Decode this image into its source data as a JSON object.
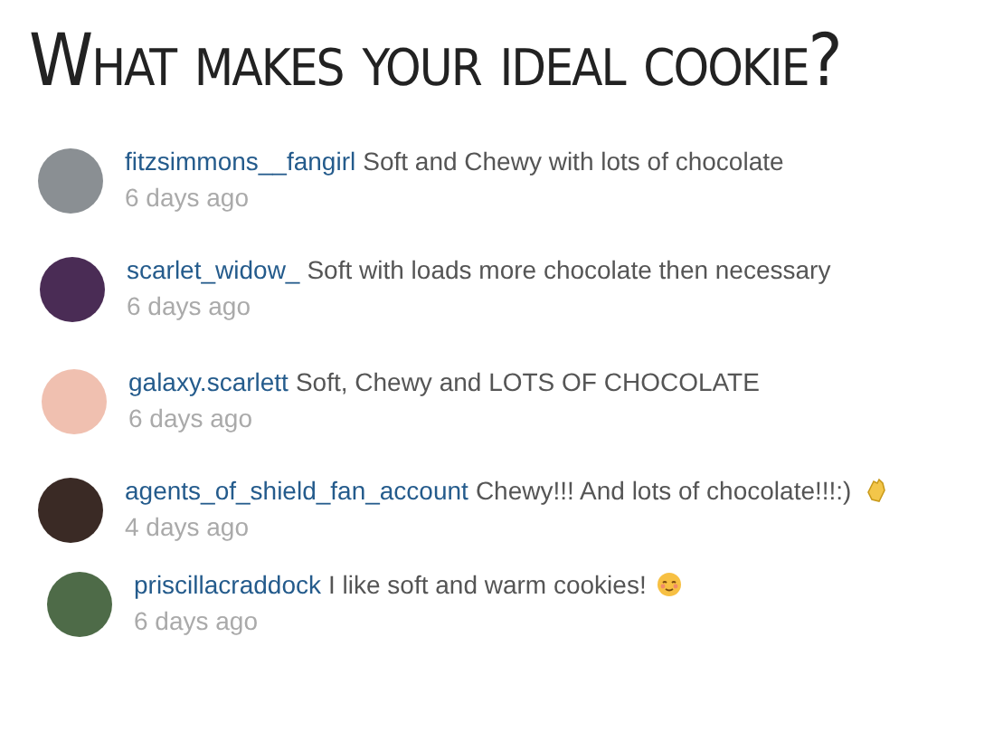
{
  "title": "What makes your ideal cookie?",
  "comments": [
    {
      "username": "fitzsimmons__fangirl",
      "text": "Soft and Chewy with lots of chocolate",
      "time": "6 days ago",
      "kind": "plain"
    },
    {
      "username": "scarlet_widow_",
      "text": "Soft with loads more chocolate then necessary",
      "time": "6 days ago",
      "kind": "plain"
    },
    {
      "username": "galaxy.scarlett",
      "text": "Soft, Chewy and LOTS OF CHOCOLATE",
      "time": "6 days ago",
      "kind": "plain"
    },
    {
      "username": "agents_of_shield_fan_account",
      "text": "Chewy!!! And lots of chocolate!!!:)",
      "time": "4 days ago",
      "kind": "clap"
    },
    {
      "username": "priscillacraddock",
      "text": "I like soft and warm cookies!",
      "time": "6 days ago",
      "kind": "smile"
    }
  ]
}
